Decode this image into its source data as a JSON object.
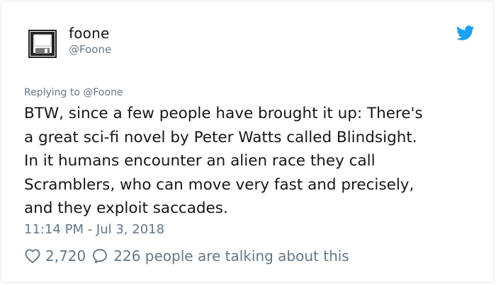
{
  "tweet": {
    "author_name": "foone",
    "author_handle": "@Foone",
    "replying_to": "Replying to @Foone",
    "text_lines": [
      "BTW, since a few people have brought it up: There's",
      "a great sci-fi novel by Peter Watts called Blindsight.",
      "In it humans encounter an alien race they call",
      "Scramblers, who can move very fast and precisely,",
      "and they exploit saccades."
    ],
    "timestamp": "11:14 PM - Jul 3, 2018",
    "likes": "2,720",
    "talking": "226 people are talking about this"
  },
  "icons": {
    "avatar": "floppy-disk-icon",
    "brand": "twitter-bird-icon",
    "likes": "heart-icon",
    "talking": "reply-bubble-icon"
  },
  "colors": {
    "text": "#14171a",
    "secondary": "#657786",
    "brand": "#1da1f2",
    "border": "#e1e8ed"
  }
}
